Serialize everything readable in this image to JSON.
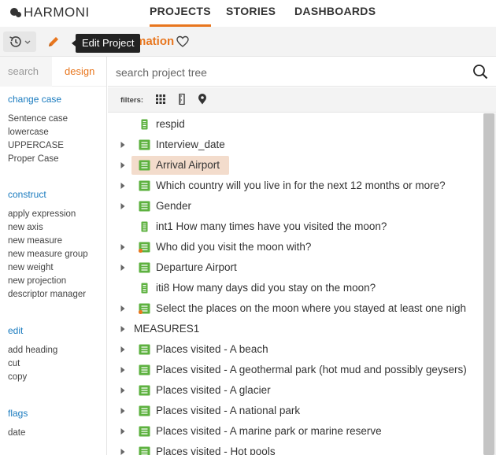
{
  "app": {
    "logo_text": "HARMONI"
  },
  "nav": {
    "tabs": [
      {
        "label": "PROJECTS"
      },
      {
        "label": "STORIES"
      },
      {
        "label": "DASHBOARDS"
      }
    ]
  },
  "toolbar": {
    "tooltip": "Edit Project",
    "project_title_fragment": "mation"
  },
  "left_panel": {
    "tabs": {
      "search": "search",
      "design": "design"
    },
    "sections": [
      {
        "heading": "change case",
        "items": [
          "Sentence case",
          "lowercase",
          "UPPERCASE",
          "Proper Case"
        ]
      },
      {
        "heading": "construct",
        "items": [
          "apply expression",
          "new axis",
          "new measure",
          "new measure group",
          "new weight",
          "new projection",
          "descriptor manager"
        ]
      },
      {
        "heading": "edit",
        "items": [
          "add heading",
          "cut",
          "copy"
        ]
      },
      {
        "heading": "flags",
        "items": [
          "date"
        ]
      }
    ]
  },
  "tree_search": {
    "placeholder": "search project tree"
  },
  "filters": {
    "label": "filters:"
  },
  "tree": {
    "rows": [
      {
        "label": "respid",
        "expandable": false,
        "icon": "text-var-icon"
      },
      {
        "label": "Interview_date",
        "expandable": true,
        "icon": "list-var-icon"
      },
      {
        "label": "Arrival Airport",
        "expandable": true,
        "icon": "list-var-icon",
        "selected": true
      },
      {
        "label": "Which country will you live in for the next 12 months or more?",
        "expandable": true,
        "icon": "list-var-icon"
      },
      {
        "label": "Gender",
        "expandable": true,
        "icon": "list-var-icon"
      },
      {
        "label": "int1 How many times have you visited the moon?",
        "expandable": false,
        "icon": "text-var-icon"
      },
      {
        "label": "Who did you visit the moon with?",
        "expandable": true,
        "icon": "list-var-flag-icon"
      },
      {
        "label": "Departure Airport",
        "expandable": true,
        "icon": "list-var-icon"
      },
      {
        "label": "iti8 How many days did you stay on the moon?",
        "expandable": false,
        "icon": "text-var-icon"
      },
      {
        "label": "Select the places on the moon where you stayed at least one nigh",
        "expandable": true,
        "icon": "list-var-flag-icon"
      },
      {
        "label": "MEASURES1",
        "expandable": true,
        "icon": "none"
      },
      {
        "label": "Places visited - A beach",
        "expandable": true,
        "icon": "list-var-icon"
      },
      {
        "label": "Places visited - A geothermal park (hot mud and possibly geysers)",
        "expandable": true,
        "icon": "list-var-icon"
      },
      {
        "label": "Places visited - A glacier",
        "expandable": true,
        "icon": "list-var-icon"
      },
      {
        "label": "Places visited - A national park",
        "expandable": true,
        "icon": "list-var-icon"
      },
      {
        "label": "Places visited - A marine park or marine reserve",
        "expandable": true,
        "icon": "list-var-icon"
      },
      {
        "label": "Places visited - Hot pools",
        "expandable": true,
        "icon": "list-var-icon"
      }
    ]
  },
  "colors": {
    "accent": "#e8761e",
    "link": "#1a7bbf",
    "var_green": "#5db13f",
    "selection": "#f3dccc"
  }
}
